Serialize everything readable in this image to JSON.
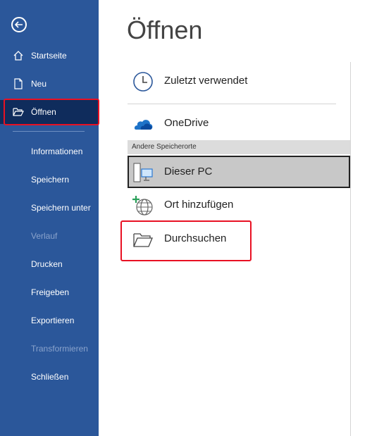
{
  "sidebar": {
    "back_label": "back",
    "items": [
      {
        "label": "Startseite"
      },
      {
        "label": "Neu"
      },
      {
        "label": "Öffnen"
      },
      {
        "label": "Informationen"
      },
      {
        "label": "Speichern"
      },
      {
        "label": "Speichern unter"
      },
      {
        "label": "Verlauf"
      },
      {
        "label": "Drucken"
      },
      {
        "label": "Freigeben"
      },
      {
        "label": "Exportieren"
      },
      {
        "label": "Transformieren"
      },
      {
        "label": "Schließen"
      }
    ]
  },
  "main": {
    "title": "Öffnen",
    "locations": [
      {
        "label": "Zuletzt verwendet",
        "icon": "clock-icon"
      },
      {
        "label": "OneDrive",
        "icon": "cloud-icon"
      }
    ],
    "other_group_label": "Andere Speicherorte",
    "other_locations": [
      {
        "label": "Dieser PC",
        "icon": "computer-icon"
      },
      {
        "label": "Ort hinzufügen",
        "icon": "globe-add-icon"
      },
      {
        "label": "Durchsuchen",
        "icon": "folder-icon"
      }
    ]
  },
  "colors": {
    "sidebar": "#2b579a",
    "active": "#0f2c5c",
    "highlight": "#e81123"
  }
}
